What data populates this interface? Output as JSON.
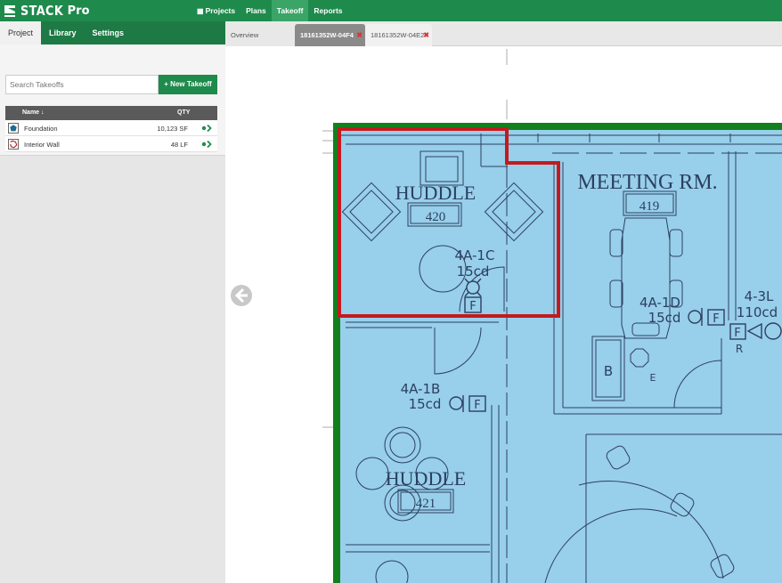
{
  "app": {
    "brand": "STACK",
    "edition": "Pro"
  },
  "nav": {
    "items": [
      {
        "label": "Projects",
        "icon": "calendar-icon",
        "active": false
      },
      {
        "label": "Plans",
        "active": false
      },
      {
        "label": "Takeoff",
        "active": true
      },
      {
        "label": "Reports",
        "active": false
      }
    ]
  },
  "sidebar": {
    "tabs": [
      "Project",
      "Library",
      "Settings"
    ],
    "active_tab": "Project",
    "search_placeholder": "Search Takeoffs",
    "new_button": "+ New Takeoff",
    "columns": {
      "name": "Name ↓",
      "qty": "QTY"
    },
    "rows": [
      {
        "name": "Foundation",
        "qty": "10,123 SF",
        "icon": "area-takeoff-icon",
        "color": "#1f6b8f"
      },
      {
        "name": "Interior Wall",
        "qty": "48 LF",
        "icon": "linear-takeoff-icon",
        "color": "#b8181e"
      }
    ]
  },
  "doc_tabs": [
    {
      "label": "Overview",
      "active": false
    },
    {
      "label": "18161352W-04F4",
      "active": true
    },
    {
      "label": "18161352W-04E2",
      "active": false
    }
  ],
  "plan": {
    "rooms": [
      {
        "name": "HUDDLE",
        "number": "420"
      },
      {
        "name": "MEETING RM.",
        "number": "419"
      },
      {
        "name": "HUDDLE",
        "number": "421"
      }
    ],
    "tags": [
      {
        "id": "4A-1C",
        "spec": "15cd"
      },
      {
        "id": "4A-1D",
        "spec": "15cd"
      },
      {
        "id": "4-3L",
        "spec": "110cd"
      },
      {
        "id": "4A-1B",
        "spec": "15cd"
      }
    ],
    "device_letters": [
      "F",
      "F",
      "F",
      "F",
      "B",
      "E",
      "R"
    ],
    "colors": {
      "fill": "#98cfea",
      "linework": "#2c4060",
      "foundation": "#13801e",
      "wall": "#c41a1f"
    }
  }
}
